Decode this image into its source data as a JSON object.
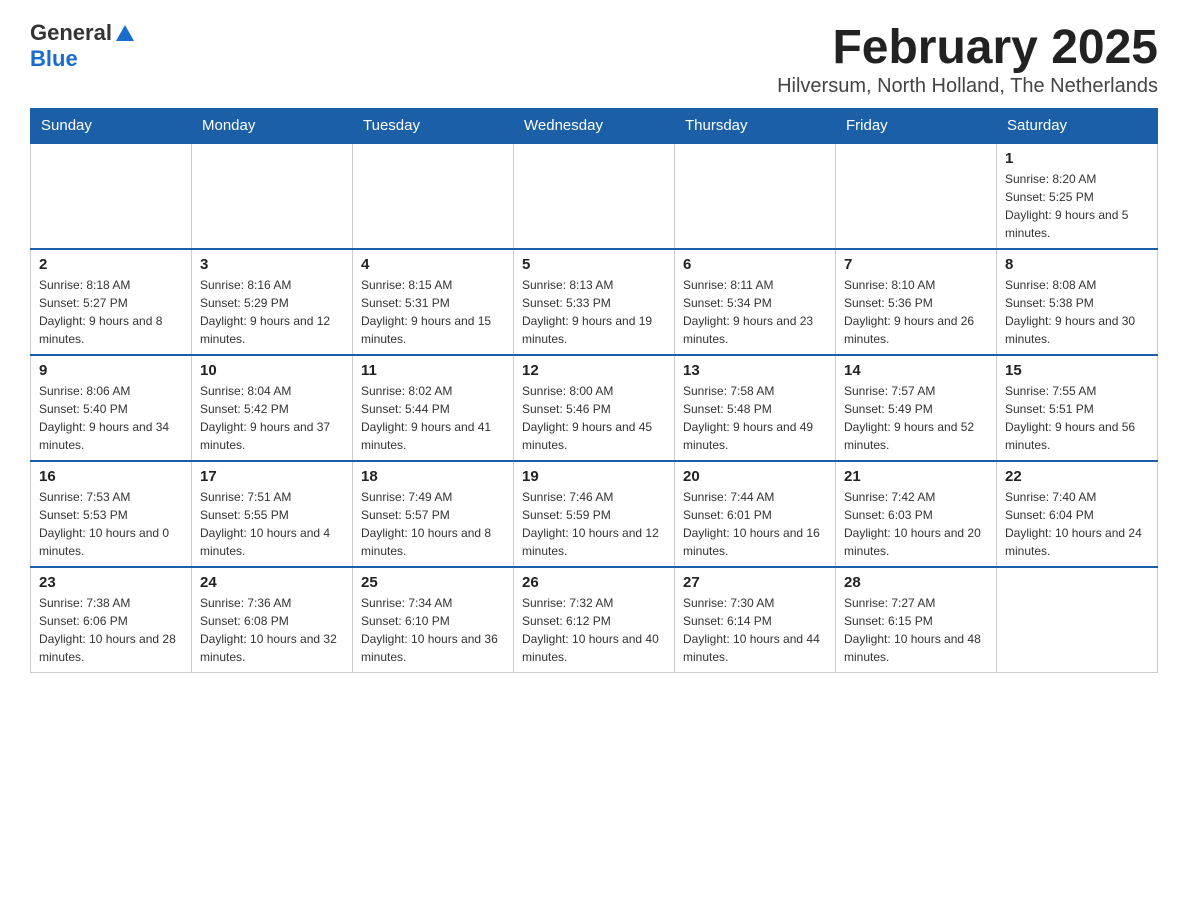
{
  "logo": {
    "general": "General",
    "triangle": "▲",
    "blue": "Blue"
  },
  "title": "February 2025",
  "subtitle": "Hilversum, North Holland, The Netherlands",
  "weekdays": [
    "Sunday",
    "Monday",
    "Tuesday",
    "Wednesday",
    "Thursday",
    "Friday",
    "Saturday"
  ],
  "weeks": [
    [
      {
        "day": "",
        "info": ""
      },
      {
        "day": "",
        "info": ""
      },
      {
        "day": "",
        "info": ""
      },
      {
        "day": "",
        "info": ""
      },
      {
        "day": "",
        "info": ""
      },
      {
        "day": "",
        "info": ""
      },
      {
        "day": "1",
        "info": "Sunrise: 8:20 AM\nSunset: 5:25 PM\nDaylight: 9 hours and 5 minutes."
      }
    ],
    [
      {
        "day": "2",
        "info": "Sunrise: 8:18 AM\nSunset: 5:27 PM\nDaylight: 9 hours and 8 minutes."
      },
      {
        "day": "3",
        "info": "Sunrise: 8:16 AM\nSunset: 5:29 PM\nDaylight: 9 hours and 12 minutes."
      },
      {
        "day": "4",
        "info": "Sunrise: 8:15 AM\nSunset: 5:31 PM\nDaylight: 9 hours and 15 minutes."
      },
      {
        "day": "5",
        "info": "Sunrise: 8:13 AM\nSunset: 5:33 PM\nDaylight: 9 hours and 19 minutes."
      },
      {
        "day": "6",
        "info": "Sunrise: 8:11 AM\nSunset: 5:34 PM\nDaylight: 9 hours and 23 minutes."
      },
      {
        "day": "7",
        "info": "Sunrise: 8:10 AM\nSunset: 5:36 PM\nDaylight: 9 hours and 26 minutes."
      },
      {
        "day": "8",
        "info": "Sunrise: 8:08 AM\nSunset: 5:38 PM\nDaylight: 9 hours and 30 minutes."
      }
    ],
    [
      {
        "day": "9",
        "info": "Sunrise: 8:06 AM\nSunset: 5:40 PM\nDaylight: 9 hours and 34 minutes."
      },
      {
        "day": "10",
        "info": "Sunrise: 8:04 AM\nSunset: 5:42 PM\nDaylight: 9 hours and 37 minutes."
      },
      {
        "day": "11",
        "info": "Sunrise: 8:02 AM\nSunset: 5:44 PM\nDaylight: 9 hours and 41 minutes."
      },
      {
        "day": "12",
        "info": "Sunrise: 8:00 AM\nSunset: 5:46 PM\nDaylight: 9 hours and 45 minutes."
      },
      {
        "day": "13",
        "info": "Sunrise: 7:58 AM\nSunset: 5:48 PM\nDaylight: 9 hours and 49 minutes."
      },
      {
        "day": "14",
        "info": "Sunrise: 7:57 AM\nSunset: 5:49 PM\nDaylight: 9 hours and 52 minutes."
      },
      {
        "day": "15",
        "info": "Sunrise: 7:55 AM\nSunset: 5:51 PM\nDaylight: 9 hours and 56 minutes."
      }
    ],
    [
      {
        "day": "16",
        "info": "Sunrise: 7:53 AM\nSunset: 5:53 PM\nDaylight: 10 hours and 0 minutes."
      },
      {
        "day": "17",
        "info": "Sunrise: 7:51 AM\nSunset: 5:55 PM\nDaylight: 10 hours and 4 minutes."
      },
      {
        "day": "18",
        "info": "Sunrise: 7:49 AM\nSunset: 5:57 PM\nDaylight: 10 hours and 8 minutes."
      },
      {
        "day": "19",
        "info": "Sunrise: 7:46 AM\nSunset: 5:59 PM\nDaylight: 10 hours and 12 minutes."
      },
      {
        "day": "20",
        "info": "Sunrise: 7:44 AM\nSunset: 6:01 PM\nDaylight: 10 hours and 16 minutes."
      },
      {
        "day": "21",
        "info": "Sunrise: 7:42 AM\nSunset: 6:03 PM\nDaylight: 10 hours and 20 minutes."
      },
      {
        "day": "22",
        "info": "Sunrise: 7:40 AM\nSunset: 6:04 PM\nDaylight: 10 hours and 24 minutes."
      }
    ],
    [
      {
        "day": "23",
        "info": "Sunrise: 7:38 AM\nSunset: 6:06 PM\nDaylight: 10 hours and 28 minutes."
      },
      {
        "day": "24",
        "info": "Sunrise: 7:36 AM\nSunset: 6:08 PM\nDaylight: 10 hours and 32 minutes."
      },
      {
        "day": "25",
        "info": "Sunrise: 7:34 AM\nSunset: 6:10 PM\nDaylight: 10 hours and 36 minutes."
      },
      {
        "day": "26",
        "info": "Sunrise: 7:32 AM\nSunset: 6:12 PM\nDaylight: 10 hours and 40 minutes."
      },
      {
        "day": "27",
        "info": "Sunrise: 7:30 AM\nSunset: 6:14 PM\nDaylight: 10 hours and 44 minutes."
      },
      {
        "day": "28",
        "info": "Sunrise: 7:27 AM\nSunset: 6:15 PM\nDaylight: 10 hours and 48 minutes."
      },
      {
        "day": "",
        "info": ""
      }
    ]
  ]
}
